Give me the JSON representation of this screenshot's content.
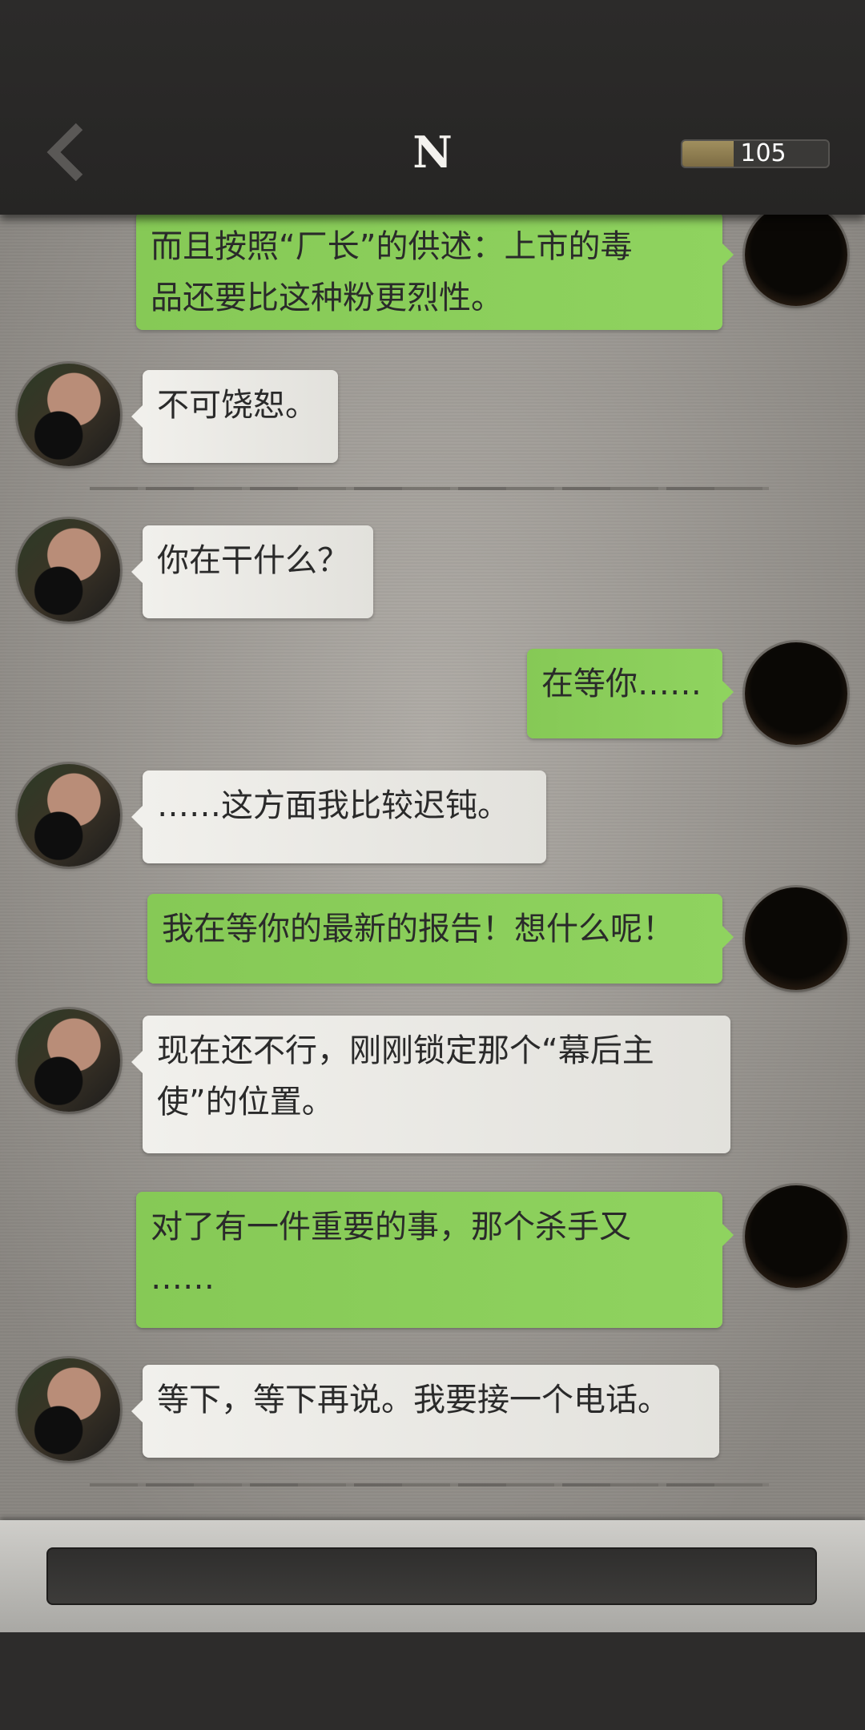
{
  "header": {
    "title": "N",
    "counter": {
      "value": "105",
      "level": 0.35
    },
    "back_icon": "chevron-left-icon"
  },
  "messages": [
    {
      "side": "right",
      "lines": [
        "而且按照“厂长”的供述：上市的毒",
        "品还要比这种粉更烈性。"
      ]
    },
    {
      "side": "left",
      "lines": [
        "不可饶恕。"
      ]
    },
    {
      "side": "left",
      "lines": [
        "你在干什么？"
      ]
    },
    {
      "side": "right",
      "lines": [
        "在等你……"
      ]
    },
    {
      "side": "left",
      "lines": [
        "……这方面我比较迟钝。"
      ]
    },
    {
      "side": "right",
      "lines": [
        "我在等你的最新的报告！想什么呢！"
      ]
    },
    {
      "side": "left",
      "lines": [
        "现在还不行，刚刚锁定那个“幕后主",
        "使”的位置。"
      ]
    },
    {
      "side": "right",
      "lines": [
        "对了有一件重要的事，那个杀手又",
        "……"
      ]
    },
    {
      "side": "left",
      "lines": [
        "等下，等下再说。我要接一个电话。"
      ]
    }
  ],
  "input": {
    "value": ""
  },
  "colors": {
    "right_bubble": "#8fd35f",
    "left_bubble": "#f1f0ec",
    "topbar": "#2b2a29"
  }
}
